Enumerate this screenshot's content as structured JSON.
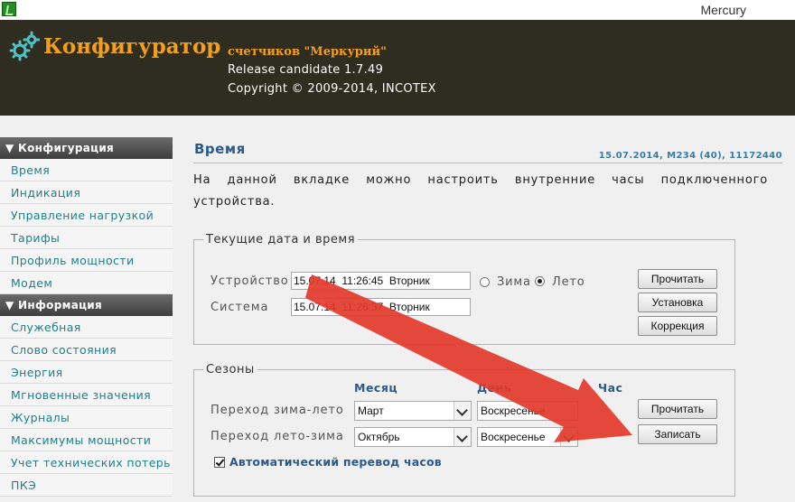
{
  "window": {
    "title": "Mercury",
    "app_icon": "app-icon"
  },
  "header": {
    "title": "Конфигуратор",
    "subtitle": "счетчиков \"Меркурий\"",
    "release": "Release candidate 1.7.49",
    "copyright": "Copyright © 2009-2014, INCOTEX",
    "accent": "#f2a01c",
    "bg": "#2f2c20"
  },
  "sidebar": {
    "sections": [
      {
        "title": "▼ Конфигурация",
        "items": [
          "Время",
          "Индикация",
          "Управление нагрузкой",
          "Тарифы",
          "Профиль мощности",
          "Модем"
        ]
      },
      {
        "title": "▼ Информация",
        "items": [
          "Служебная",
          "Слово состояния",
          "Энергия",
          "Мгновенные значения",
          "Журналы",
          "Максимумы мощности",
          "Учет технических потерь",
          "ПКЭ"
        ]
      }
    ]
  },
  "main": {
    "title": "Время",
    "meta": "15.07.2014, M234 (40), 11172440",
    "description": "На данной вкладке можно настроить внутренние часы подключенного устройства.",
    "current": {
      "legend": "Текущие дата и время",
      "device_label": "Устройство",
      "device_value": "15.07.14  11:26:45  Вторник",
      "system_label": "Система",
      "system_value": "15.07.14  11:26:37  Вторник",
      "radio_winter": "Зима",
      "radio_summer": "Лето",
      "selected_season": "Лето",
      "btn_read": "Прочитать",
      "btn_set": "Установка",
      "btn_correct": "Коррекция"
    },
    "seasons": {
      "legend": "Сезоны",
      "col_month": "Месяц",
      "col_day": "День",
      "col_hour": "Час",
      "row1_label": "Переход зима-лето",
      "row1_month": "Март",
      "row1_day": "Воскресенье",
      "row2_label": "Переход лето-зима",
      "row2_month": "Октябрь",
      "row2_day": "Воскресенье",
      "btn_read": "Прочитать",
      "btn_write": "Записать",
      "auto_dst_label": "Автоматический перевод часов",
      "auto_dst_checked": true
    }
  },
  "overlay": {
    "arrow_color": "#e23a2a"
  }
}
